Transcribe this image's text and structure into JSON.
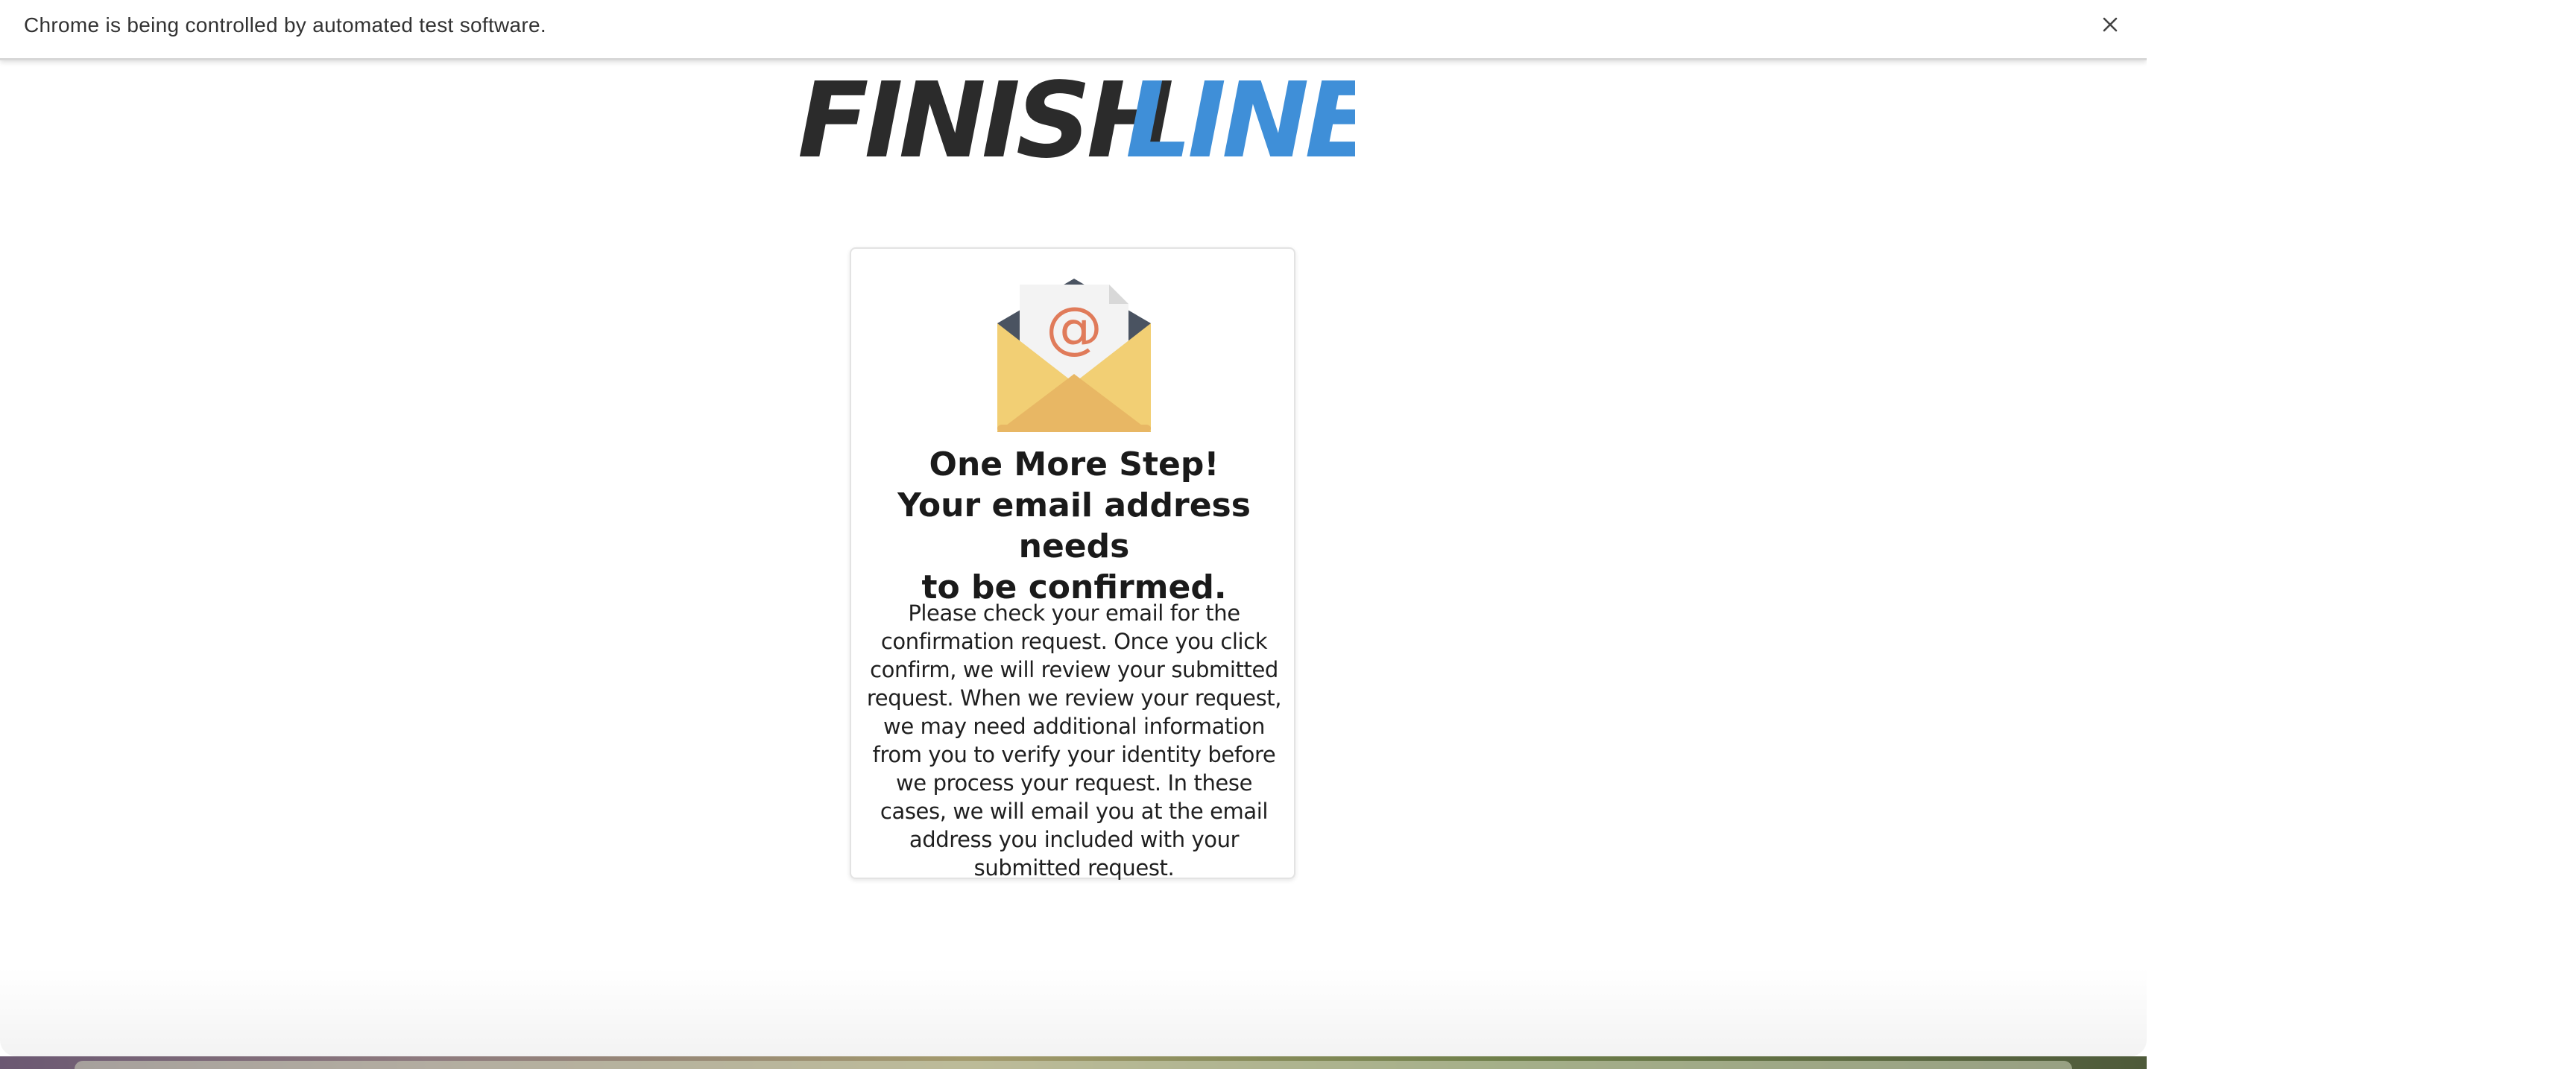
{
  "infobar": {
    "message": "Chrome is being controlled by automated test software.",
    "close_icon": "close-icon"
  },
  "logo": {
    "word1": "FINISH",
    "word2": "LINE",
    "trademark": "™",
    "word1_color": "#2b2b2b",
    "word2_color": "#3f8fd8"
  },
  "card": {
    "icon": "email-envelope-icon",
    "title_line1": "One More Step!",
    "title_line2": "Your email address needs",
    "title_line3": "to be confirmed.",
    "body": "Please check your email for the confirmation request. Once you click confirm, we will review your submitted request. When we review your request, we may need additional information from you to verify your identity before we process your request. In these cases, we will email you at the email address you included with your submitted request."
  },
  "colors": {
    "envelope_light": "#f2cf74",
    "envelope_dark": "#e8b764",
    "envelope_flap": "#4a5361",
    "letter": "#f3f3f3",
    "at_sign": "#e07b5a"
  }
}
